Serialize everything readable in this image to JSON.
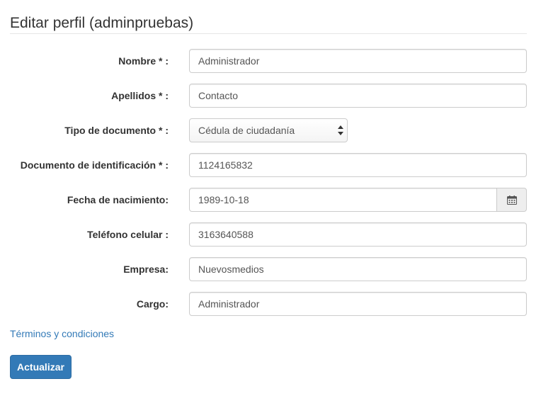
{
  "page": {
    "title": "Editar perfil (adminpruebas)"
  },
  "form": {
    "nombre": {
      "label": "Nombre * :",
      "value": "Administrador"
    },
    "apellidos": {
      "label": "Apellidos * :",
      "value": "Contacto"
    },
    "tipo_documento": {
      "label": "Tipo de documento * :",
      "selected": "Cédula de ciudadanía"
    },
    "documento": {
      "label": "Documento de identificación * :",
      "value": "1124165832"
    },
    "fecha_nacimiento": {
      "label": "Fecha de nacimiento:",
      "value": "1989-10-18",
      "icon": "calendar-icon"
    },
    "telefono": {
      "label": "Teléfono celular :",
      "value": "3163640588"
    },
    "empresa": {
      "label": "Empresa:",
      "value": "Nuevosmedios"
    },
    "cargo": {
      "label": "Cargo:",
      "value": "Administrador"
    }
  },
  "links": {
    "terminos": "Términos y condiciones"
  },
  "actions": {
    "submit_label": "Actualizar"
  },
  "colors": {
    "primary": "#337ab7",
    "link": "#337ab7",
    "border": "#cccccc",
    "addon_bg": "#eeeeee"
  }
}
